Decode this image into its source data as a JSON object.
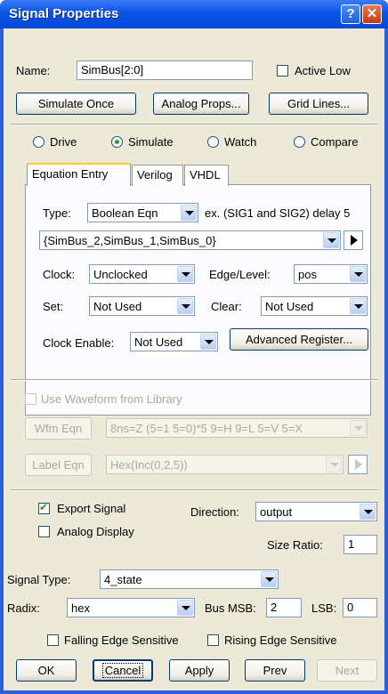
{
  "window": {
    "title": "Signal Properties",
    "help_glyph": "?",
    "close_glyph": "✕"
  },
  "name": {
    "label": "Name:",
    "value": "SimBus[2:0]",
    "active_low": "Active Low"
  },
  "buttons_top": {
    "simulate_once": "Simulate Once",
    "analog_props": "Analog Props...",
    "grid_lines": "Grid Lines..."
  },
  "modes": [
    {
      "label": "Drive",
      "selected": false
    },
    {
      "label": "Simulate",
      "selected": true
    },
    {
      "label": "Watch",
      "selected": false
    },
    {
      "label": "Compare",
      "selected": false
    }
  ],
  "tabs": [
    {
      "label": "Equation Entry",
      "active": true
    },
    {
      "label": "Verilog",
      "active": false
    },
    {
      "label": "VHDL",
      "active": false
    }
  ],
  "equation": {
    "type_label": "Type:",
    "type_value": "Boolean Eqn",
    "example": "ex. (SIG1 and SIG2) delay 5",
    "expr_value": "{SimBus_2,SimBus_1,SimBus_0}",
    "clock_label": "Clock:",
    "clock_value": "Unclocked",
    "edge_label": "Edge/Level:",
    "edge_value": "pos",
    "set_label": "Set:",
    "set_value": "Not Used",
    "clear_label": "Clear:",
    "clear_value": "Not Used",
    "clock_enable_label": "Clock Enable:",
    "clock_enable_value": "Not Used",
    "advanced_register": "Advanced Register..."
  },
  "waveform": {
    "use_library": "Use Waveform from Library",
    "wfm_eqn_btn": "Wfm Eqn",
    "wfm_eqn_value": "8ns=Z (5=1 5=0)*5 9=H 9=L 5=V 5=X",
    "label_eqn_btn": "Label Eqn",
    "label_eqn_value": "Hex(Inc(0,2,5))"
  },
  "export": {
    "export_signal": "Export Signal",
    "export_checked": true,
    "analog_display": "Analog Display",
    "analog_checked": false,
    "direction_label": "Direction:",
    "direction_value": "output",
    "size_ratio_label": "Size Ratio:",
    "size_ratio_value": "1"
  },
  "signal_type": {
    "label": "Signal Type:",
    "value": "4_state"
  },
  "radix": {
    "label": "Radix:",
    "value": "hex",
    "msb_label": "Bus MSB:",
    "msb_value": "2",
    "lsb_label": "LSB:",
    "lsb_value": "0"
  },
  "edges": {
    "falling": "Falling Edge Sensitive",
    "rising": "Rising Edge Sensitive"
  },
  "footer": {
    "ok": "OK",
    "cancel": "Cancel",
    "apply": "Apply",
    "prev": "Prev",
    "next": "Next"
  }
}
